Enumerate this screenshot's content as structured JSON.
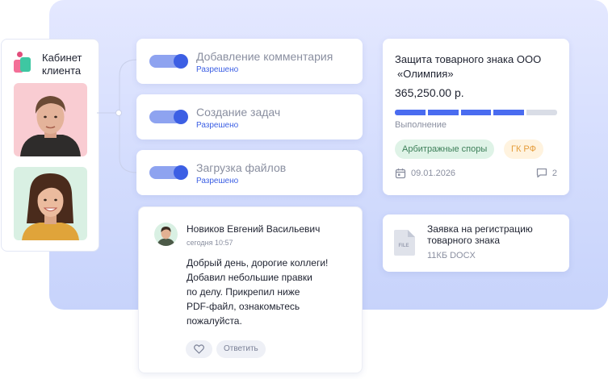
{
  "client": {
    "title_line1": "Кабинет",
    "title_line2": "клиента"
  },
  "permissions": [
    {
      "label": "Добавление комментария",
      "status": "Разрешено",
      "enabled": true
    },
    {
      "label": "Создание задач",
      "status": "Разрешено",
      "enabled": true
    },
    {
      "label": "Загрузка файлов",
      "status": "Разрешено",
      "enabled": true
    }
  ],
  "deal": {
    "title_line1": "Защита товарного знака ООО",
    "title_line2": "«Олимпия»",
    "amount": "365,250.00 р.",
    "progress_label": "Выполнение",
    "progress_segments_done": 4,
    "progress_segments_total": 5,
    "tags": [
      "Арбитражные споры",
      "ГК РФ"
    ],
    "date": "09.01.2026",
    "comments_count": "2"
  },
  "file": {
    "title_line1": "Заявка на регистрацию",
    "title_line2": "товарного знака",
    "meta": "11КБ DOCX",
    "icon_label": "FILE"
  },
  "comment": {
    "author": "Новиков Евгений Васильевич",
    "time": "сегодня 10:57",
    "lines": [
      "Добрый день, дорогие коллеги!",
      "Добавил небольшие правки",
      "по делу. Прикрепил ниже",
      "PDF-файл, ознакомьтесь",
      "пожалуйста."
    ],
    "reply_label": "Ответить"
  },
  "colors": {
    "accent": "#3c5fe4",
    "progress_done": "#4a6cf0",
    "progress_rest": "#d9dde6",
    "tag_green": "#dff3e7",
    "tag_orange": "#fff3df"
  },
  "icons": [
    "client-logo",
    "calendar-icon",
    "comment-icon",
    "file-icon",
    "heart-icon"
  ]
}
